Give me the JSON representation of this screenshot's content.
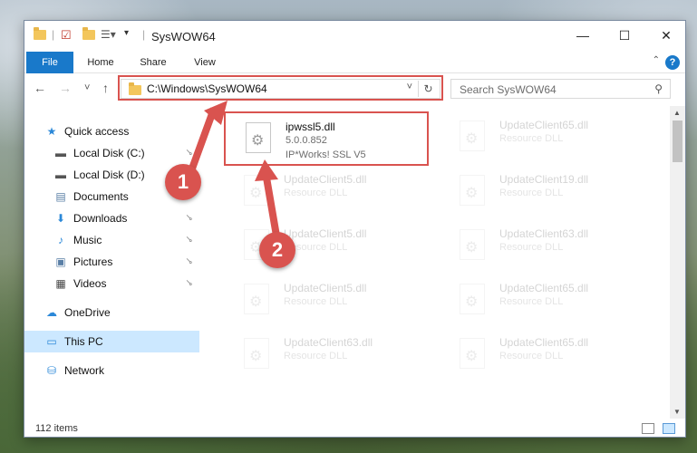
{
  "window": {
    "title": "SysWOW64",
    "minimize_glyph": "—",
    "maximize_glyph": "☐",
    "close_glyph": "✕"
  },
  "ribbon": {
    "tabs": [
      {
        "label": "File"
      },
      {
        "label": "Home"
      },
      {
        "label": "Share"
      },
      {
        "label": "View"
      }
    ],
    "help_glyph": "?",
    "collapse_glyph": "⌃"
  },
  "nav": {
    "back_glyph": "←",
    "forward_glyph": "→",
    "recent_glyph": "˅",
    "up_glyph": "↑"
  },
  "address": {
    "path": "C:\\Windows\\SysWOW64",
    "dropdown_glyph": "˅",
    "refresh_glyph": "↻"
  },
  "search": {
    "placeholder": "Search SysWOW64",
    "icon_glyph": "⚲"
  },
  "sidebar": {
    "items": [
      {
        "label": "Quick access",
        "icon": "star-icon",
        "glyph": "★",
        "color": "#2b88d8",
        "pinned": false
      },
      {
        "label": "Local Disk (C:)",
        "icon": "drive-icon",
        "glyph": "▬",
        "color": "#555555",
        "pinned": true
      },
      {
        "label": "Local Disk (D:)",
        "icon": "drive-icon",
        "glyph": "▬",
        "color": "#555555",
        "pinned": true
      },
      {
        "label": "Documents",
        "icon": "document-icon",
        "glyph": "▤",
        "color": "#5a7fa6",
        "pinned": true
      },
      {
        "label": "Downloads",
        "icon": "download-icon",
        "glyph": "⬇",
        "color": "#2b88d8",
        "pinned": true
      },
      {
        "label": "Music",
        "icon": "music-icon",
        "glyph": "♪",
        "color": "#2b88d8",
        "pinned": true
      },
      {
        "label": "Pictures",
        "icon": "picture-icon",
        "glyph": "▣",
        "color": "#5a7fa6",
        "pinned": true
      },
      {
        "label": "Videos",
        "icon": "video-icon",
        "glyph": "▦",
        "color": "#444444",
        "pinned": true
      },
      {
        "label": "OneDrive",
        "icon": "cloud-icon",
        "glyph": "☁",
        "color": "#2b88d8",
        "pinned": false
      },
      {
        "label": "This PC",
        "icon": "computer-icon",
        "glyph": "▭",
        "color": "#2b88d8",
        "pinned": false,
        "selected": true
      },
      {
        "label": "Network",
        "icon": "network-icon",
        "glyph": "⛁",
        "color": "#2b88d8",
        "pinned": false
      }
    ]
  },
  "files": [
    {
      "name": "ipwssl5.dll",
      "version": "5.0.0.852",
      "description": "IP*Works! SSL V5",
      "highlighted": true
    },
    {
      "name": "UpdateClient65.dll",
      "description": "Resource DLL"
    },
    {
      "name": "UpdateClient5.dll",
      "description": "Resource DLL"
    },
    {
      "name": "UpdateClient19.dll",
      "description": "Resource DLL"
    },
    {
      "name": "UpdateClient5.dll",
      "description": "Resource DLL"
    },
    {
      "name": "UpdateClient63.dll",
      "description": "Resource DLL"
    },
    {
      "name": "UpdateClient5.dll",
      "description": "Resource DLL"
    },
    {
      "name": "UpdateClient65.dll",
      "description": "Resource DLL"
    },
    {
      "name": "UpdateClient63.dll",
      "description": "Resource DLL"
    },
    {
      "name": "UpdateClient65.dll",
      "description": "Resource DLL"
    }
  ],
  "status": {
    "item_count": "112 items"
  },
  "callouts": [
    {
      "label": "1"
    },
    {
      "label": "2"
    }
  ],
  "colors": {
    "accent": "#1979ca",
    "callout": "#d9534f",
    "selected": "#cce8ff"
  }
}
